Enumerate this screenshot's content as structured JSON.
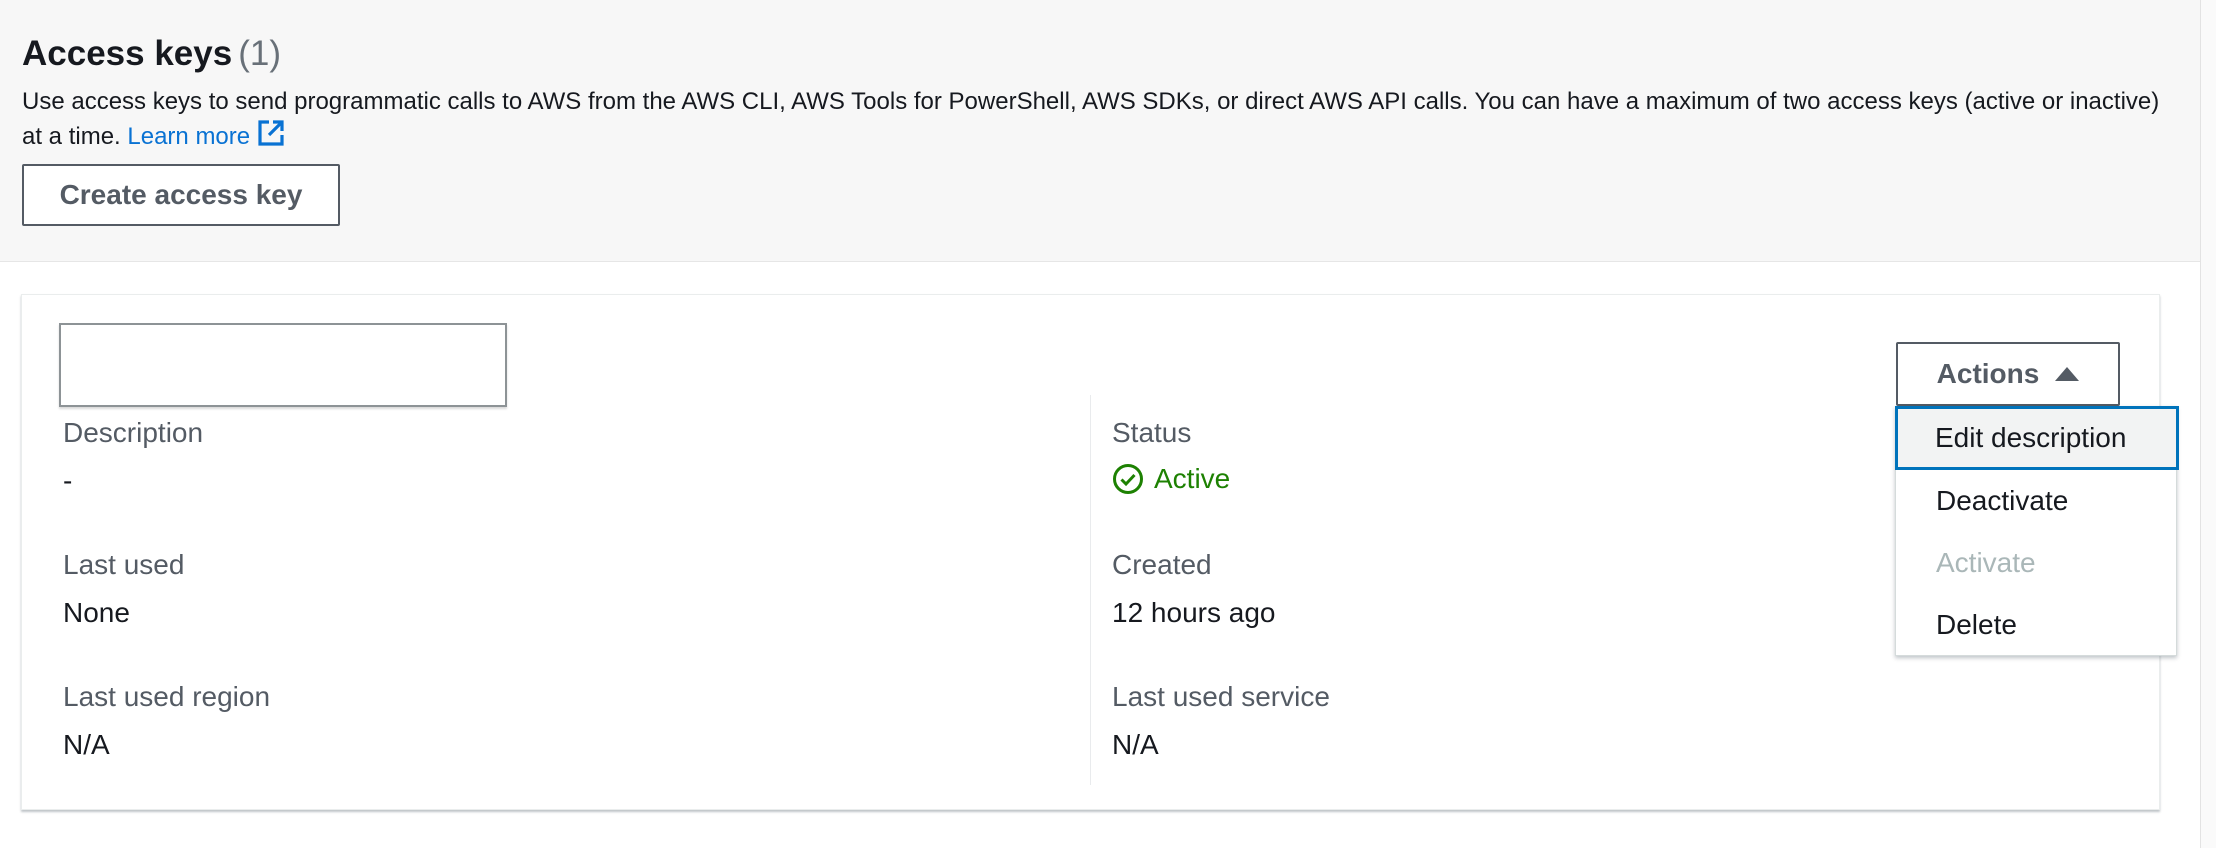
{
  "header": {
    "title": "Access keys",
    "count": "(1)",
    "description": "Use access keys to send programmatic calls to AWS from the AWS CLI, AWS Tools for PowerShell, AWS SDKs, or direct AWS API calls. You can have a maximum of two access keys (active or inactive) at a time.",
    "learn_more": "Learn more",
    "external_link_icon": "external-link-icon",
    "create_button": "Create access key"
  },
  "key_card": {
    "key_id": "",
    "fields": {
      "description_label": "Description",
      "description_value": "-",
      "last_used_label": "Last used",
      "last_used_value": "None",
      "last_used_region_label": "Last used region",
      "last_used_region_value": "N/A",
      "status_label": "Status",
      "status_value": "Active",
      "status_icon": "check-circle-icon",
      "created_label": "Created",
      "created_value": "12 hours ago",
      "last_used_service_label": "Last used service",
      "last_used_service_value": "N/A"
    },
    "actions": {
      "button_label": "Actions",
      "expanded": true,
      "items": [
        {
          "label": "Edit description",
          "state": "focused"
        },
        {
          "label": "Deactivate",
          "state": "enabled"
        },
        {
          "label": "Activate",
          "state": "disabled"
        },
        {
          "label": "Delete",
          "state": "enabled"
        }
      ]
    }
  },
  "colors": {
    "link": "#0972d3",
    "success": "#1d8102",
    "focus_ring": "#0073bb",
    "disabled_text": "#aab7b8"
  }
}
